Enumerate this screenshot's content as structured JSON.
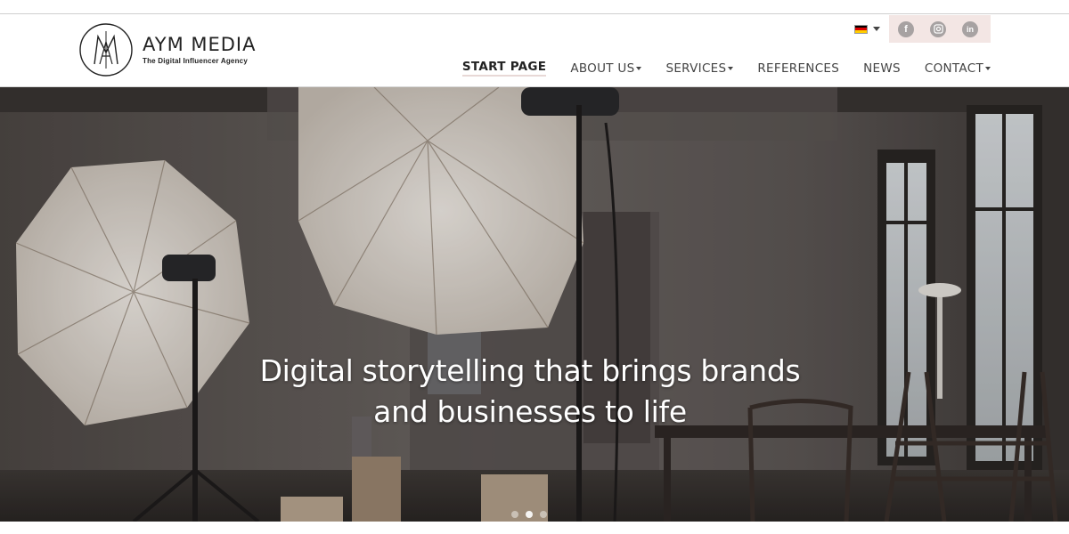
{
  "brand": {
    "name": "AYM MEDIA",
    "tagline": "The Digital Influencer Agency"
  },
  "language": {
    "icon": "german-flag-icon",
    "colors": [
      "#000000",
      "#dd0000",
      "#ffce00"
    ]
  },
  "social": [
    {
      "name": "facebook-icon",
      "glyph": "f"
    },
    {
      "name": "instagram-icon",
      "glyph": ""
    },
    {
      "name": "linkedin-icon",
      "glyph": "in"
    }
  ],
  "nav": {
    "items": [
      {
        "label": "START PAGE",
        "active": true,
        "dropdown": false
      },
      {
        "label": "ABOUT US",
        "active": false,
        "dropdown": true
      },
      {
        "label": "SERVICES",
        "active": false,
        "dropdown": true
      },
      {
        "label": "REFERENCES",
        "active": false,
        "dropdown": false
      },
      {
        "label": "NEWS",
        "active": false,
        "dropdown": false
      },
      {
        "label": "CONTACT",
        "active": false,
        "dropdown": true
      }
    ]
  },
  "hero": {
    "headline_line1": "Digital storytelling that brings brands",
    "headline_line2": "and businesses to life",
    "slides": 3,
    "active_slide": 1
  },
  "colors": {
    "social_bg": "#f3e6e4",
    "social_icon": "#a7a2a2",
    "active_underline": "#e8d8d6"
  }
}
